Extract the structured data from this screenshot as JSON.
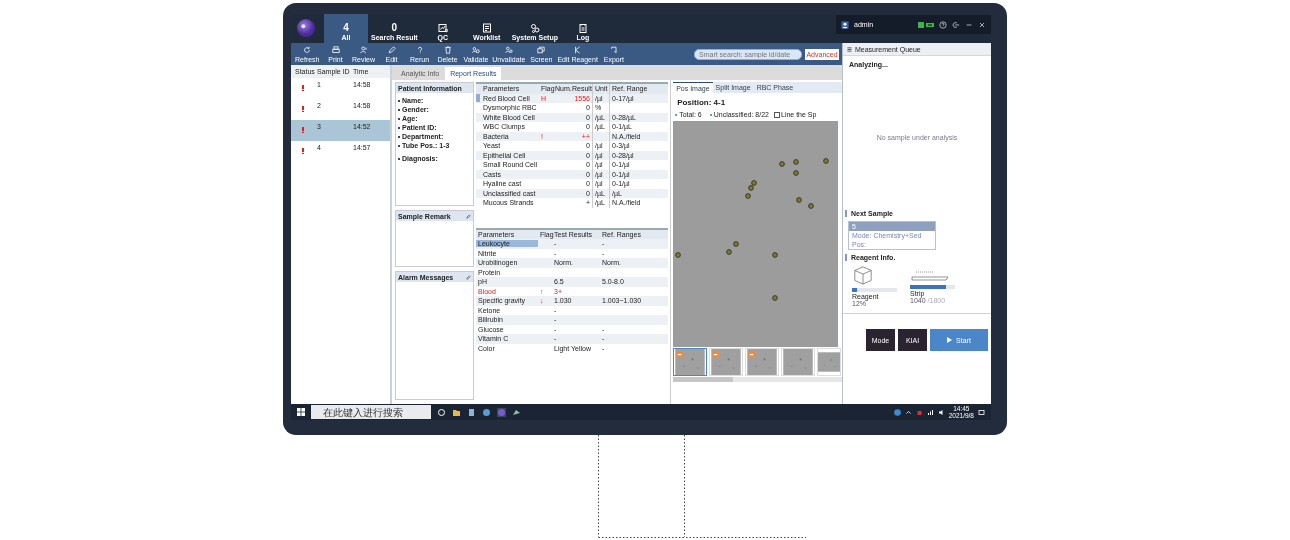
{
  "nav_tabs": [
    {
      "kind": "count",
      "count": "4",
      "label": "All",
      "selected": true
    },
    {
      "kind": "count",
      "count": "0",
      "label": "Search Result",
      "selected": false
    },
    {
      "kind": "chart",
      "label": "QC",
      "selected": false
    },
    {
      "kind": "list",
      "label": "Worklist",
      "selected": false
    },
    {
      "kind": "gears",
      "label": "System Setup",
      "selected": false
    },
    {
      "kind": "notepad",
      "label": "Log",
      "selected": false
    }
  ],
  "user": {
    "name": "admin"
  },
  "toolbar": [
    {
      "kind": "refresh",
      "label": "Refresh"
    },
    {
      "kind": "print",
      "label": "Print"
    },
    {
      "kind": "review",
      "label": "Review"
    },
    {
      "kind": "edit",
      "label": "Edit"
    },
    {
      "kind": "rerun",
      "label": "Rerun"
    },
    {
      "kind": "delete",
      "label": "Delete"
    },
    {
      "kind": "validate",
      "label": "Validate"
    },
    {
      "kind": "unvalidate",
      "label": "Unvalidate"
    },
    {
      "kind": "screen",
      "label": "Screen"
    },
    {
      "kind": "reagent",
      "label": "Edit Reagent"
    },
    {
      "kind": "export",
      "label": "Export"
    }
  ],
  "search": {
    "placeholder": "Smart search: sample id/date",
    "button": "Advanced"
  },
  "sample_list": {
    "columns": [
      "Status",
      "Sample ID",
      "Time"
    ],
    "rows": [
      {
        "sample_id": "1",
        "time": "14:58",
        "selected": false
      },
      {
        "sample_id": "2",
        "time": "14:58",
        "selected": false
      },
      {
        "sample_id": "3",
        "time": "14:52",
        "selected": true
      },
      {
        "sample_id": "4",
        "time": "14:57",
        "selected": false
      }
    ]
  },
  "sub_tabs": [
    {
      "label": "Analytic Info",
      "selected": false
    },
    {
      "label": "Report Results",
      "selected": true
    }
  ],
  "patient_info": {
    "title": "Patient Information",
    "fields": [
      {
        "label": "Name:"
      },
      {
        "label": "Gender:"
      },
      {
        "label": "Age:"
      },
      {
        "label": "Patient ID:"
      },
      {
        "label": "Department:"
      },
      {
        "label": "Tube Pos.:",
        "value": "1-3"
      },
      {
        "label": "Diagnosis:"
      }
    ]
  },
  "sample_remark": {
    "title": "Sample Remark"
  },
  "alarm_messages": {
    "title": "Alarm Messages"
  },
  "sediment": {
    "columns": [
      "Parameters",
      "Flag",
      "Num.",
      "Result",
      "Unit",
      "Ref. Range"
    ],
    "rows": [
      {
        "name": "Red Blood Cell",
        "flag": "H",
        "result": "1556",
        "unit": "/µl",
        "range": "0-17/µl",
        "abnormal": true,
        "selected": true
      },
      {
        "name": "Dysmorphic RBC",
        "flag": "",
        "result": "0",
        "unit": "%",
        "range": "",
        "abnormal": false,
        "selected": false
      },
      {
        "name": "White Blood Cell",
        "flag": "",
        "result": "0",
        "unit": "/µL",
        "range": "0-28/µL",
        "abnormal": false,
        "selected": false
      },
      {
        "name": "WBC Clumps",
        "flag": "",
        "result": "0",
        "unit": "/µL",
        "range": "0-1/µL",
        "abnormal": false,
        "selected": false
      },
      {
        "name": "Bacteria",
        "flag": "!",
        "result": "++",
        "unit": "",
        "range": "N.A./field",
        "abnormal": true,
        "selected": false
      },
      {
        "name": "Yeast",
        "flag": "",
        "result": "0",
        "unit": "/µl",
        "range": "0-3/µl",
        "abnormal": false,
        "selected": false
      },
      {
        "name": "Epithelial Cell",
        "flag": "",
        "result": "0",
        "unit": "/µl",
        "range": "0-28/µl",
        "abnormal": false,
        "selected": false
      },
      {
        "name": "Small Round Cell",
        "flag": "",
        "result": "0",
        "unit": "/µl",
        "range": "0-1/µl",
        "abnormal": false,
        "selected": false
      },
      {
        "name": "Casts",
        "flag": "",
        "result": "0",
        "unit": "/µl",
        "range": "0-1/µl",
        "abnormal": false,
        "selected": false
      },
      {
        "name": "Hyaline cast",
        "flag": "",
        "result": "0",
        "unit": "/µl",
        "range": "0-1/µl",
        "abnormal": false,
        "selected": false
      },
      {
        "name": "Unclassified cast",
        "flag": "",
        "result": "0",
        "unit": "/µL",
        "range": "/µL",
        "abnormal": false,
        "selected": false
      },
      {
        "name": "Mucous Strands",
        "flag": "",
        "result": "+",
        "unit": "/µL",
        "range": "N.A./field",
        "abnormal": false,
        "selected": false
      }
    ]
  },
  "chemistry": {
    "columns": [
      "Parameters",
      "Flag",
      "Test Results",
      "Ref. Ranges"
    ],
    "rows": [
      {
        "name": "Leukocyte",
        "flag": "",
        "result": "-",
        "range": "-",
        "abnormal": false,
        "selected": true
      },
      {
        "name": "Nitrite",
        "flag": "",
        "result": "-",
        "range": "-",
        "abnormal": false,
        "selected": false
      },
      {
        "name": "Urobilinogen",
        "flag": "",
        "result": "Norm.",
        "range": "Norm.",
        "abnormal": false,
        "selected": false
      },
      {
        "name": "Protein",
        "flag": "",
        "result": "",
        "range": "",
        "abnormal": false,
        "selected": false
      },
      {
        "name": "pH",
        "flag": "",
        "result": "6.5",
        "range": "5.0-8.0",
        "abnormal": false,
        "selected": false
      },
      {
        "name": "Blood",
        "flag": "↑",
        "result": "3+",
        "range": "",
        "abnormal": true,
        "selected": false
      },
      {
        "name": "Specific gravity",
        "flag": "↓",
        "result": "1.030",
        "range": "1.003~1.030",
        "abnormal": false,
        "selected": false
      },
      {
        "name": "Ketone",
        "flag": "",
        "result": "-",
        "range": "",
        "abnormal": false,
        "selected": false
      },
      {
        "name": "Bilirubin",
        "flag": "",
        "result": "-",
        "range": "",
        "abnormal": false,
        "selected": false
      },
      {
        "name": "Glucose",
        "flag": "",
        "result": "-",
        "range": "-",
        "abnormal": false,
        "selected": false
      },
      {
        "name": "Vitamin C",
        "flag": "",
        "result": "-",
        "range": "-",
        "abnormal": false,
        "selected": false
      },
      {
        "name": "Color",
        "flag": "",
        "result": "Light Yellow",
        "range": "-",
        "abnormal": false,
        "selected": false
      }
    ]
  },
  "image_panel": {
    "tabs": [
      {
        "label": "Pos Image",
        "selected": true
      },
      {
        "label": "Split Image",
        "selected": false
      },
      {
        "label": "RBC Phase",
        "selected": false
      }
    ],
    "position": "Position: 4-1",
    "total": "Total: 6",
    "unclassified": "Unclassified: 8/22",
    "checkbox": {
      "label": "Line the Sp",
      "checked": false
    },
    "thumbnails": [
      {
        "flagged": true,
        "selected": true
      },
      {
        "flagged": true,
        "selected": false
      },
      {
        "flagged": true,
        "selected": false
      },
      {
        "flagged": false,
        "selected": false
      },
      {
        "flagged": false,
        "selected": false
      }
    ]
  },
  "queue": {
    "title": "Measurement Queue",
    "status": "Analyzing...",
    "message": "No sample under analysis",
    "next_title": "Next Sample",
    "next_sample": {
      "id": "5",
      "mode": "Mode: Chemistry+Sed",
      "position": "Pos:"
    },
    "reagent_title": "Reagent Info.",
    "reagents": [
      {
        "kind": "reagent",
        "label": "Reagent",
        "level": 0.12,
        "reading": "12%"
      },
      {
        "kind": "strip",
        "label": "Strip",
        "level": 0.8,
        "reading": "1040",
        "total": "/1800"
      }
    ],
    "buttons": [
      {
        "kind": "dark",
        "label": "Mode"
      },
      {
        "kind": "dark",
        "label": "KIAI"
      },
      {
        "kind": "primary",
        "label": "Start"
      }
    ]
  },
  "taskbar": {
    "search_placeholder": "在此键入进行搜索",
    "time": "14:45",
    "date": "2021/9/8"
  }
}
